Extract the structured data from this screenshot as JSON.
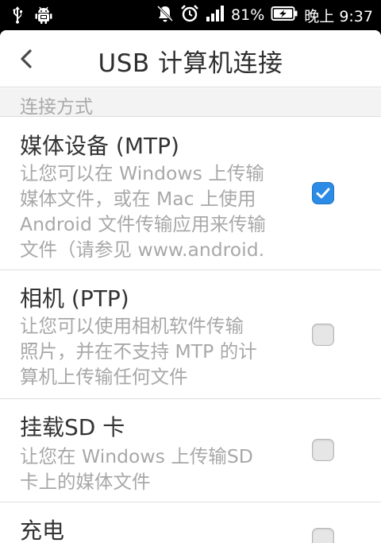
{
  "status_bar": {
    "left_icons": [
      "usb-icon",
      "android-debug-icon"
    ],
    "right_icons": [
      "mute-icon",
      "alarm-clock-icon",
      "signal-icon",
      "battery-charging-icon"
    ],
    "battery": "81%",
    "time": "晚上 9:37"
  },
  "header": {
    "title": "USB 计算机连接",
    "back_icon": "chevron-left-icon"
  },
  "section": {
    "title": "连接方式"
  },
  "items": [
    {
      "title": "媒体设备 (MTP)",
      "desc_lines": [
        "让您可以在 Windows 上传输",
        "媒体文件，或在 Mac 上使用",
        "Android 文件传输应用来传输",
        "文件（请参见 www.android."
      ],
      "checked": true
    },
    {
      "title": "相机 (PTP)",
      "desc_lines": [
        "让您可以使用相机软件传输",
        "照片，并在不支持 MTP 的计",
        "算机上传输任何文件"
      ],
      "checked": false
    },
    {
      "title": "挂载SD 卡",
      "desc_lines": [
        "让您在 Windows 上传输SD",
        "卡上的媒体文件"
      ],
      "checked": false
    },
    {
      "title": "充电",
      "desc_lines": [],
      "checked": false
    }
  ],
  "colors": {
    "accent": "#2b8be6",
    "secondary_text": "#a8a8a8",
    "primary_text": "#333333"
  }
}
